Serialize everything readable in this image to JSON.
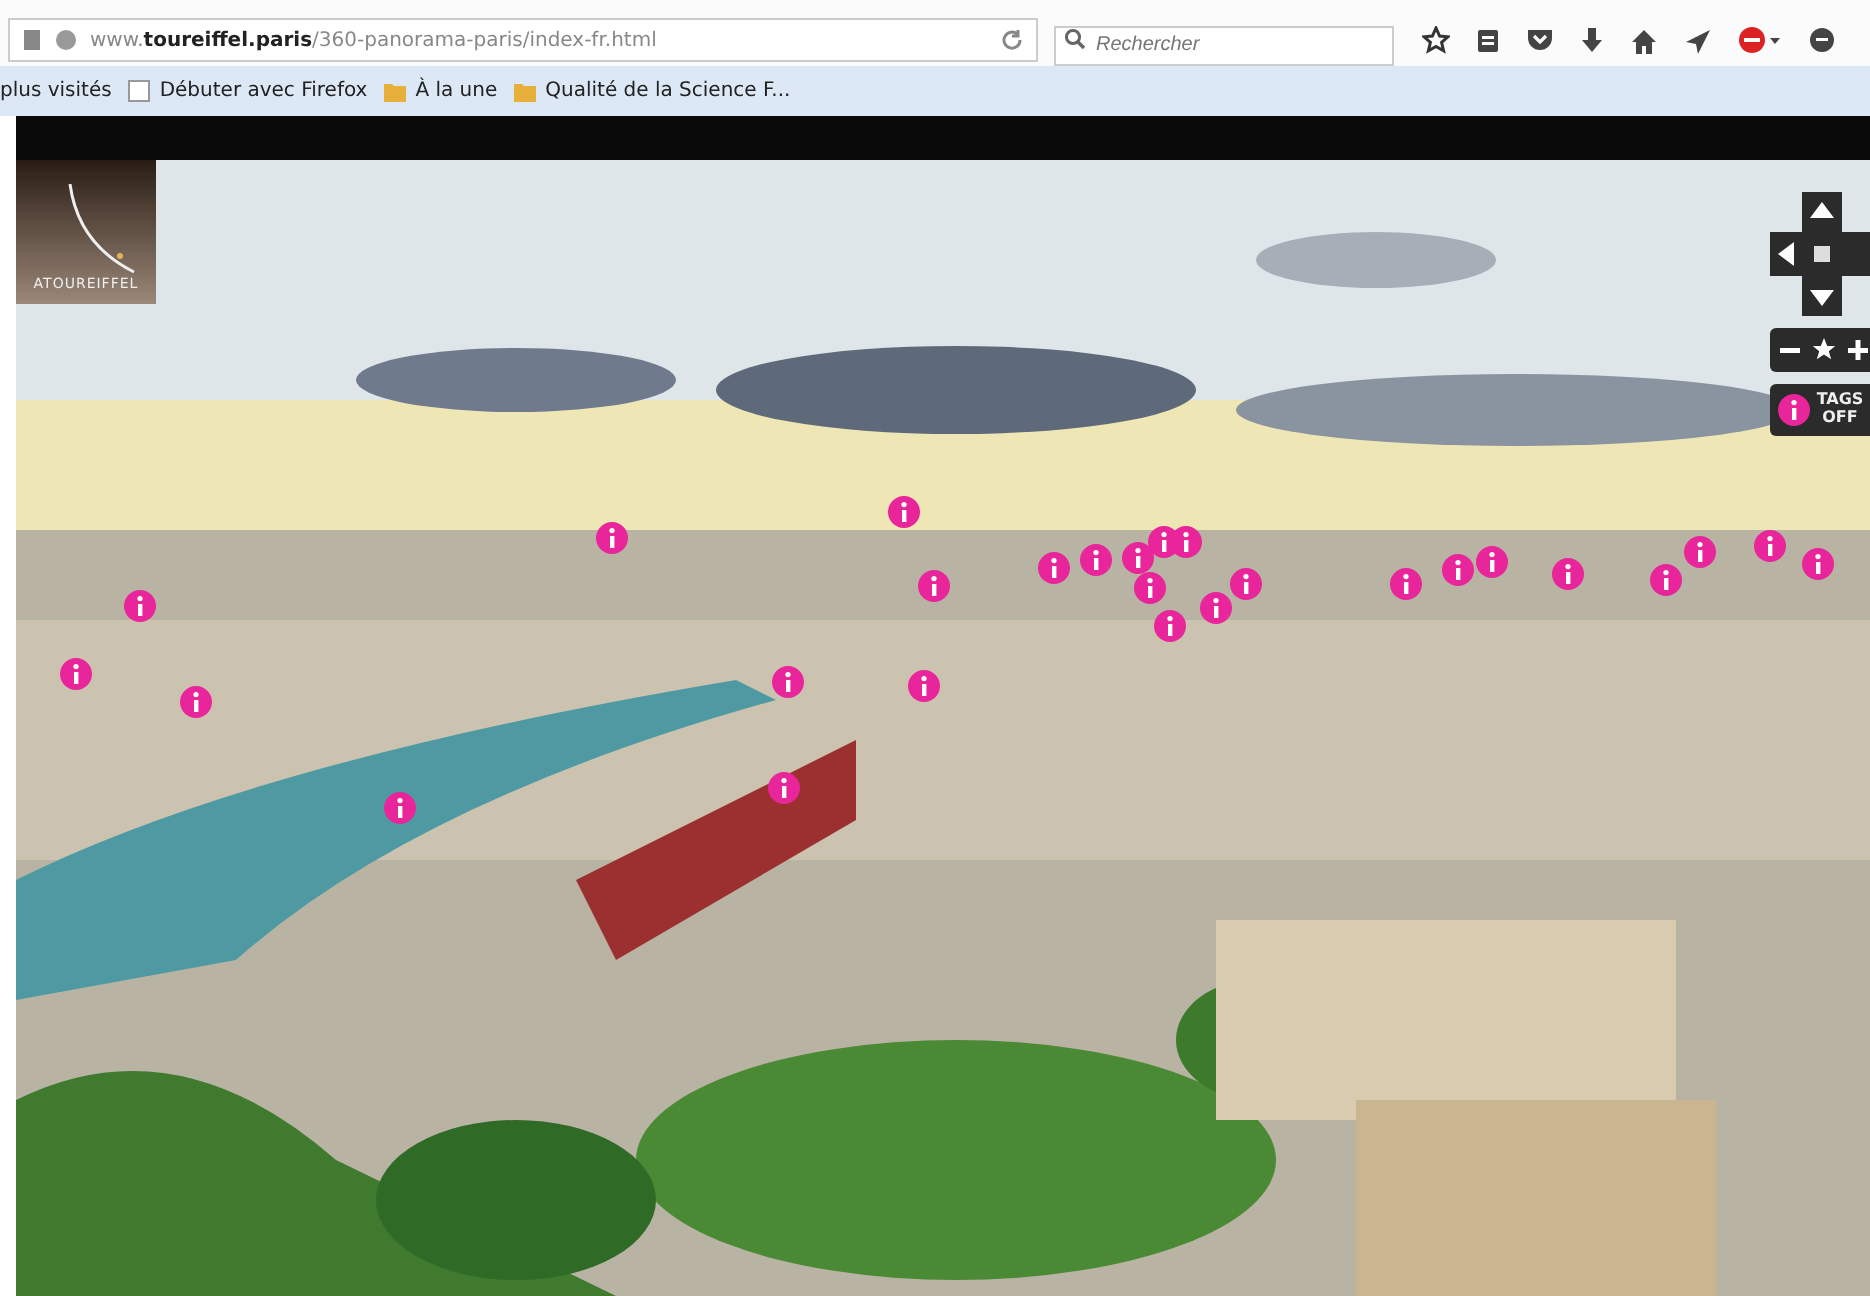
{
  "address_bar": {
    "url": "www.**toureiffel.paris**/360-panorama-paris/index-fr.html"
  },
  "search": {
    "placeholder": "Rechercher"
  },
  "bookmarks": [
    {
      "label": "plus visités",
      "kind": "text"
    },
    {
      "label": "Débuter avec Firefox",
      "kind": "page"
    },
    {
      "label": "À la une",
      "kind": "feed"
    },
    {
      "label": "Qualité de la Science F...",
      "kind": "feed"
    }
  ],
  "logo": {
    "text": "ATOUREIFFEL"
  },
  "tags_button": {
    "label": "TAGS OFF"
  }
}
